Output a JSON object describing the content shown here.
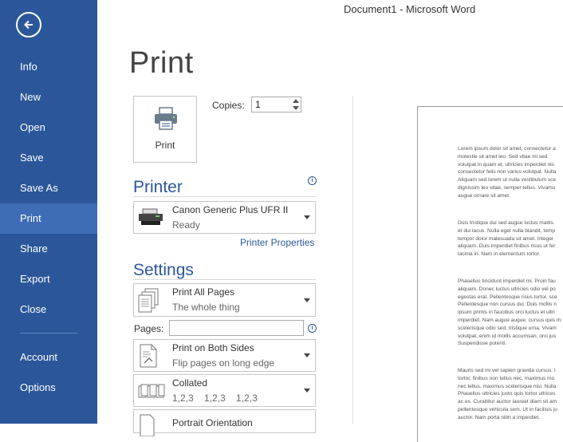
{
  "window": {
    "title": "Document1 - Microsoft Word"
  },
  "sidebar": {
    "back_icon": "arrow-left-circle-icon",
    "items": [
      {
        "label": "Info",
        "active": false
      },
      {
        "label": "New",
        "active": false
      },
      {
        "label": "Open",
        "active": false
      },
      {
        "label": "Save",
        "active": false
      },
      {
        "label": "Save As",
        "active": false
      },
      {
        "label": "Print",
        "active": true
      },
      {
        "label": "Share",
        "active": false
      },
      {
        "label": "Export",
        "active": false
      },
      {
        "label": "Close",
        "active": false
      },
      {
        "label": "Account",
        "active": false
      },
      {
        "label": "Options",
        "active": false
      }
    ],
    "color": "#2b579a",
    "active_color": "#3e6db5"
  },
  "main": {
    "title": "Print",
    "print_button": {
      "label": "Print",
      "icon": "printer-icon"
    },
    "copies": {
      "label": "Copies:",
      "value": "1"
    },
    "printer": {
      "heading": "Printer",
      "name": "Canon Generic Plus UFR II",
      "status": "Ready",
      "properties_link": "Printer Properties",
      "icon": "printer-device-icon"
    },
    "settings": {
      "heading": "Settings",
      "pages_range": {
        "title": "Print All Pages",
        "subtitle": "The whole thing",
        "icon": "pages-stack-icon"
      },
      "pages_label": "Pages:",
      "pages_value": "",
      "sides": {
        "title": "Print on Both Sides",
        "subtitle": "Flip pages on long edge",
        "icon": "duplex-icon"
      },
      "collation": {
        "title": "Collated",
        "subtitle": "1,2,3    1,2,3    1,2,3",
        "icon": "collated-icon"
      },
      "orientation": {
        "title": "Portrait Orientation",
        "icon": "portrait-icon"
      }
    },
    "accent": "#2b579a"
  },
  "preview": {
    "paragraphs": [
      "Lorem ipsum dolor sit amet, consectetur a\nmolestie sit amet leo. Sed vitae mi sed\nvolutpat in quam et, ultricies imperdiet nis\nconsectetur felis non varius volutpat. Nulla\nAliquam sed lorem ut nulla vestibulum sce\ndignissim leo vitae, semper tellus. Vivamu\naugue ornare sit amet.",
      "Duis tristique dui sed augue luctus mattis.\net dui lacus. Nulla eget nulla blandit, temp\ntempor dolor malesuada sit amet. Integer\naliquam. Duis imperdiet finibus risus ut fer\nlacinia in. Nam in elementum tortor.",
      "Phasellus tincidunt imperdiet mi. Proin fau\naliquam. Donec luctus ultricies odio vel po\negestas erat. Pellentesque risus tortor, sce\nPellentesque non cursus dui. Duis mollis n\nipsum primis in faucibus orci luctus et ultri\nimperdiet. Nam augue augue, cursus quis m\nscelerisque odio sed, tristique urna. Vivam\nvolutpat, enim id mollis accumsan, orci jus\nSuspendisse potenti.",
      "Mauris sed mi vel sapien gravida cursus. I\ntortor, finibus non tellus nec, maximus mo\nnec tellus, maximus scelerisque nisl. Nulla\nPhasellus ultricies justo quis tortor ultrices\nac ex. Curabitur auctor laoreet diam sit am\npellentesque vehicula sem. Ut in facilisis ju\nauctor. Nam porta nibh a imperdiet."
    ]
  }
}
